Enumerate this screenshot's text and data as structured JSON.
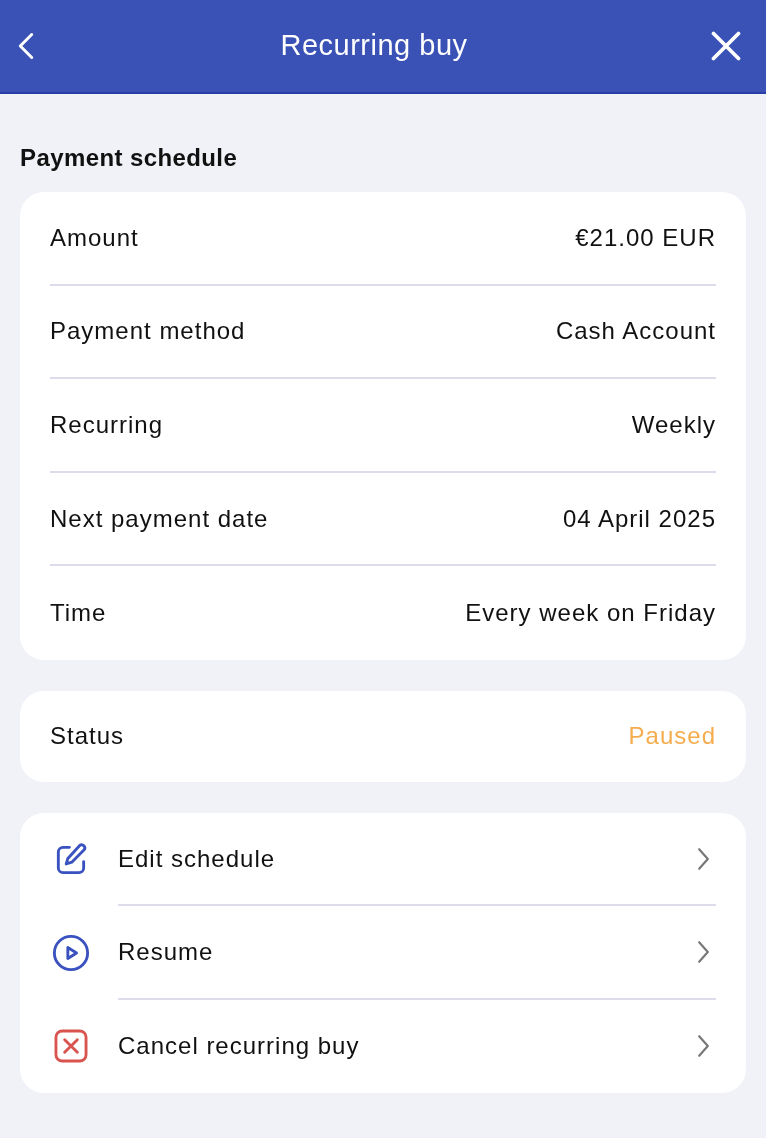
{
  "header": {
    "title": "Recurring buy"
  },
  "schedule": {
    "heading": "Payment schedule",
    "rows": [
      {
        "label": "Amount",
        "value": "€21.00 EUR"
      },
      {
        "label": "Payment method",
        "value": "Cash Account"
      },
      {
        "label": "Recurring",
        "value": "Weekly"
      },
      {
        "label": "Next payment date",
        "value": "04 April 2025"
      },
      {
        "label": "Time",
        "value": "Every week on Friday"
      }
    ]
  },
  "status": {
    "label": "Status",
    "value": "Paused",
    "color": "#f5ac4d"
  },
  "actions": [
    {
      "kind": "edit",
      "label": "Edit schedule"
    },
    {
      "kind": "resume",
      "label": "Resume"
    },
    {
      "kind": "cancel",
      "label": "Cancel recurring buy"
    }
  ]
}
